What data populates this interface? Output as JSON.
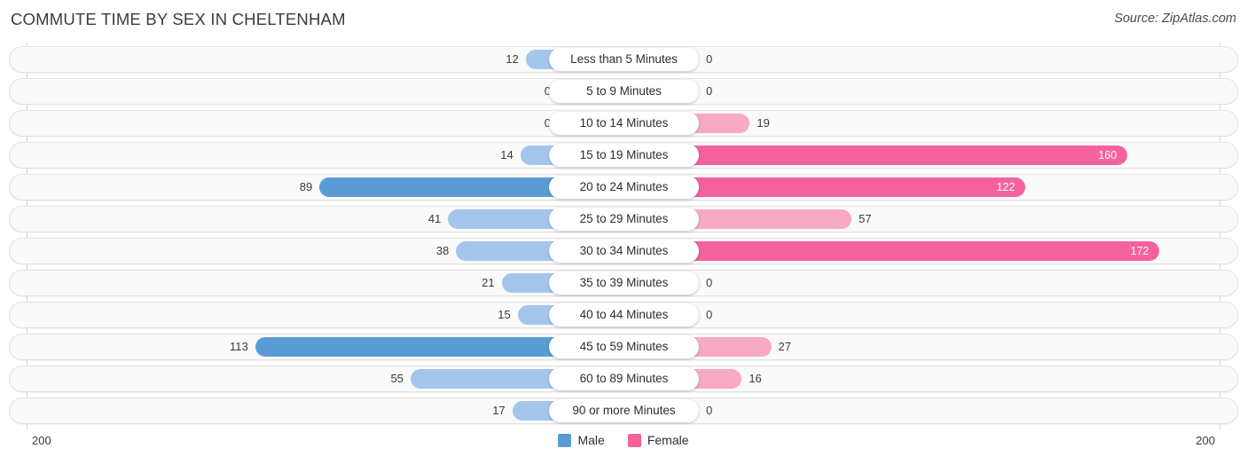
{
  "header": {
    "title": "COMMUTE TIME BY SEX IN CHELTENHAM",
    "source": "Source: ZipAtlas.com"
  },
  "axis": {
    "left_tick": "200",
    "right_tick": "200",
    "max": 200
  },
  "legend": {
    "items": [
      {
        "label": "Male",
        "color": "#5b9bd5"
      },
      {
        "label": "Female",
        "color": "#f4629b"
      }
    ]
  },
  "colors": {
    "male_strong": "#5b9bd5",
    "male_light": "#a3c6ea",
    "female_strong": "#f4629b",
    "female_light": "#f8a9c4",
    "track_fill": "#fafafa",
    "track_border": "#e3e3e3"
  },
  "chart_data": {
    "type": "bar",
    "subtype": "diverging-bidirectional",
    "title": "COMMUTE TIME BY SEX IN CHELTENHAM",
    "xlabel": "",
    "ylabel": "",
    "xlim": [
      200,
      200
    ],
    "grid": false,
    "legend_position": "bottom-center",
    "categories": [
      "Less than 5 Minutes",
      "5 to 9 Minutes",
      "10 to 14 Minutes",
      "15 to 19 Minutes",
      "20 to 24 Minutes",
      "25 to 29 Minutes",
      "30 to 34 Minutes",
      "35 to 39 Minutes",
      "40 to 44 Minutes",
      "45 to 59 Minutes",
      "60 to 89 Minutes",
      "90 or more Minutes"
    ],
    "series": [
      {
        "name": "Male",
        "direction": "left",
        "values": [
          12,
          0,
          0,
          14,
          89,
          41,
          38,
          21,
          15,
          113,
          55,
          17
        ]
      },
      {
        "name": "Female",
        "direction": "right",
        "values": [
          0,
          0,
          19,
          160,
          122,
          57,
          172,
          0,
          0,
          27,
          16,
          0
        ]
      }
    ]
  },
  "rows": [
    {
      "category": "Less than 5 Minutes",
      "male": "12",
      "female": "0"
    },
    {
      "category": "5 to 9 Minutes",
      "male": "0",
      "female": "0"
    },
    {
      "category": "10 to 14 Minutes",
      "male": "0",
      "female": "19"
    },
    {
      "category": "15 to 19 Minutes",
      "male": "14",
      "female": "160"
    },
    {
      "category": "20 to 24 Minutes",
      "male": "89",
      "female": "122"
    },
    {
      "category": "25 to 29 Minutes",
      "male": "41",
      "female": "57"
    },
    {
      "category": "30 to 34 Minutes",
      "male": "38",
      "female": "172"
    },
    {
      "category": "35 to 39 Minutes",
      "male": "21",
      "female": "0"
    },
    {
      "category": "40 to 44 Minutes",
      "male": "15",
      "female": "0"
    },
    {
      "category": "45 to 59 Minutes",
      "male": "113",
      "female": "27"
    },
    {
      "category": "60 to 89 Minutes",
      "male": "55",
      "female": "16"
    },
    {
      "category": "90 or more Minutes",
      "male": "17",
      "female": "0"
    }
  ]
}
